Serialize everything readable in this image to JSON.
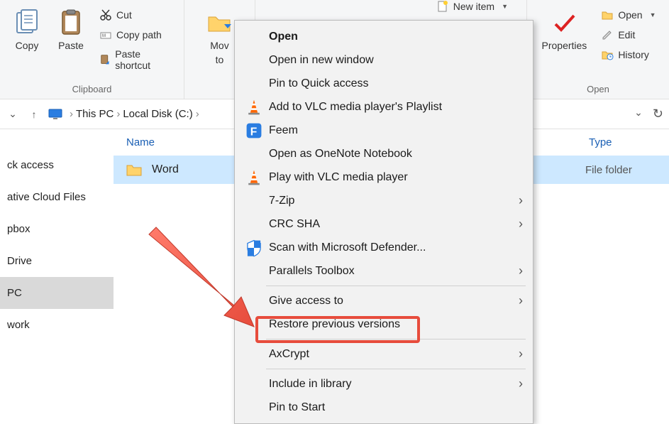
{
  "ribbon": {
    "clipboard": {
      "copy": "Copy",
      "paste": "Paste",
      "cut": "Cut",
      "copy_path": "Copy path",
      "paste_shortcut": "Paste shortcut",
      "group_label": "Clipboard"
    },
    "organize": {
      "move": "Mov",
      "move_second": "to"
    },
    "new": {
      "new_item": "New item"
    },
    "open": {
      "properties": "Properties",
      "open": "Open",
      "edit": "Edit",
      "history": "History",
      "group_label": "Open"
    }
  },
  "breadcrumb": {
    "this_pc": "This PC",
    "drive": "Local Disk (C:)"
  },
  "sidebar": {
    "items": [
      "ck access",
      "ative Cloud Files",
      "pbox",
      "Drive",
      "PC",
      "work"
    ]
  },
  "columns": {
    "name": "Name",
    "type": "Type"
  },
  "files": [
    {
      "name": "Word",
      "type": "File folder"
    }
  ],
  "context_menu": {
    "open": "Open",
    "open_new_window": "Open in new window",
    "pin_quick": "Pin to Quick access",
    "vlc_playlist": "Add to VLC media player's Playlist",
    "feem": "Feem",
    "onenote": "Open as OneNote Notebook",
    "vlc_play": "Play with VLC media player",
    "sevenzip": "7-Zip",
    "crc_sha": "CRC SHA",
    "defender": "Scan with Microsoft Defender...",
    "parallels": "Parallels Toolbox",
    "give_access": "Give access to",
    "restore": "Restore previous versions",
    "axcrypt": "AxCrypt",
    "include_library": "Include in library",
    "pin_start": "Pin to Start"
  }
}
